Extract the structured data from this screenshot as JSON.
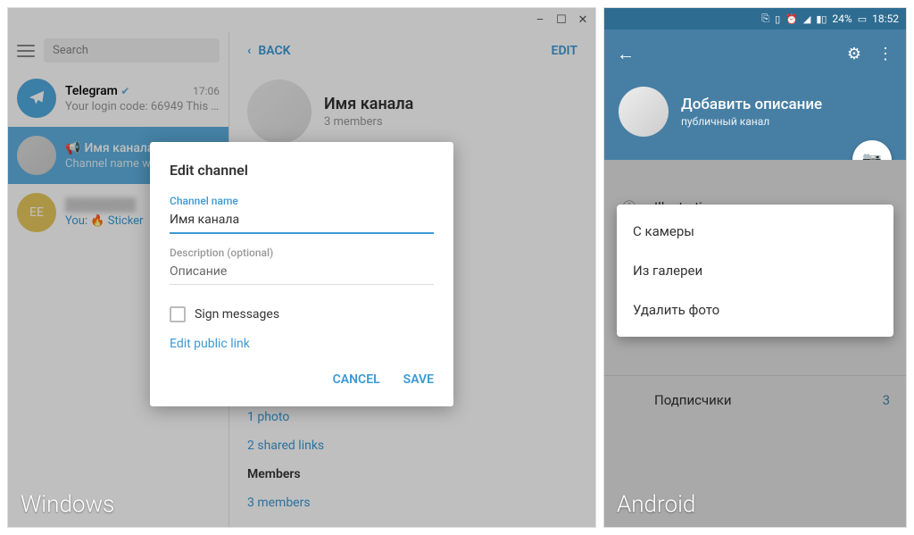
{
  "windows": {
    "titlebar": {
      "min": "–",
      "max": "☐",
      "close": "✕"
    },
    "search_placeholder": "Search",
    "chats": [
      {
        "name": "Telegram",
        "verified": "✔",
        "time": "17:06",
        "msg": "Your login code: 66949  This c..."
      },
      {
        "name": "Имя канала",
        "time": "",
        "msg": "Channel name wa..."
      },
      {
        "name": "",
        "time": "",
        "msg": "You: 🔥 Sticker",
        "initials": "EE"
      }
    ],
    "back_label": "BACK",
    "edit_label": "EDIT",
    "channel": {
      "name": "Имя канала",
      "members": "3 members"
    },
    "sections": {
      "photo": "1 photo",
      "links": "2 shared links",
      "members_hdr": "Members",
      "members_count": "3 members"
    },
    "dialog": {
      "title": "Edit channel",
      "name_label": "Channel name",
      "name_value": "Имя канала",
      "desc_label": "Description (optional)",
      "desc_value": "Описание",
      "sign_label": "Sign messages",
      "edit_link": "Edit public link",
      "cancel": "CANCEL",
      "save": "SAVE"
    },
    "platform": "Windows"
  },
  "android": {
    "status": {
      "battery": "24%",
      "time": "18:52"
    },
    "header": {
      "title": "Добавить описание",
      "sub": "публичный канал"
    },
    "rows": {
      "illustrations": "Illustrations",
      "subscribers": "Подписчики",
      "subscribers_count": "3"
    },
    "menu": {
      "camera": "С камеры",
      "gallery": "Из галереи",
      "delete": "Удалить фото"
    },
    "platform": "Android"
  }
}
